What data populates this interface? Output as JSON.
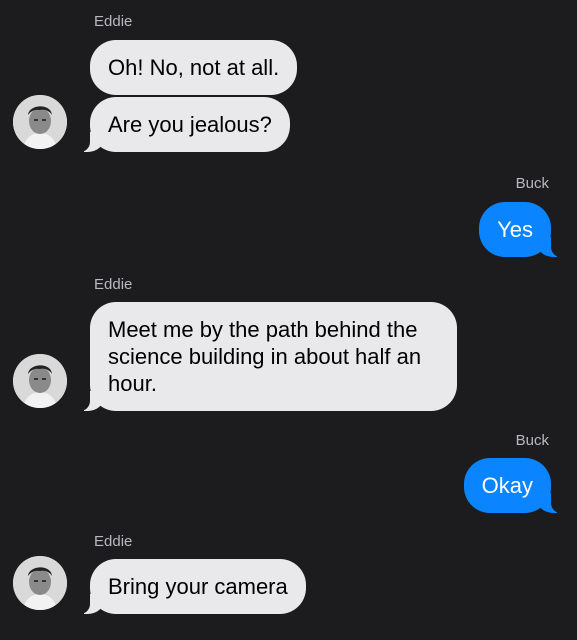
{
  "conversation": {
    "messages": [
      {
        "sender": "Eddie",
        "side": "left",
        "text": "Oh! No, not at all."
      },
      {
        "sender": "Eddie",
        "side": "left",
        "text": "Are you jealous?"
      },
      {
        "sender": "Buck",
        "side": "right",
        "text": "Yes"
      },
      {
        "sender": "Eddie",
        "side": "left",
        "lines": [
          "Meet me by the path behind the",
          "science building in about half an",
          "hour."
        ]
      },
      {
        "sender": "Buck",
        "side": "right",
        "text": "Okay"
      },
      {
        "sender": "Eddie",
        "side": "left",
        "text": "Bring your camera"
      }
    ]
  },
  "colors": {
    "background": "#1c1c1e",
    "incoming_bubble": "#e9e9eb",
    "outgoing_bubble": "#0a84ff",
    "sender_label": "#b9b9be"
  },
  "icons": {
    "avatar": "contact-avatar-photo"
  }
}
